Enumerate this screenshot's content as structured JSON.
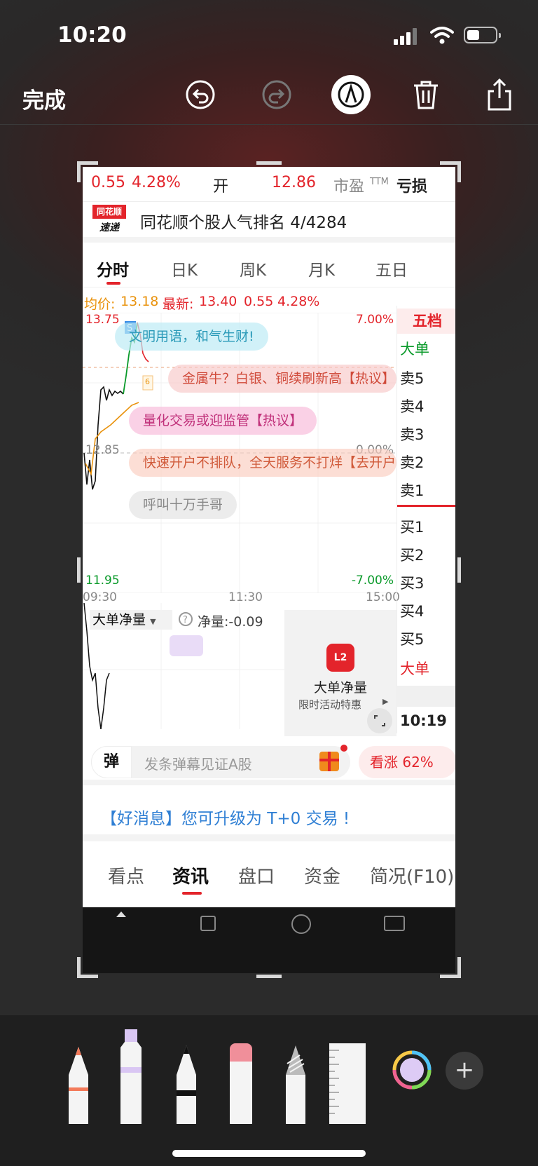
{
  "status": {
    "time": "10:20"
  },
  "toolbar": {
    "done": "完成",
    "icons": [
      "undo-icon",
      "redo-icon",
      "markup-pen-icon",
      "trash-icon",
      "share-icon"
    ]
  },
  "quote": {
    "change": "0.55",
    "percent": "4.28%",
    "open_label": "开",
    "open_value": "12.86",
    "pe_label": "市盈",
    "pe_sub": "TTM",
    "pe_value": "亏损"
  },
  "rank": {
    "logo_top": "同花顺",
    "logo_bottom": "速递",
    "text": "同花顺个股人气排名 4/4284"
  },
  "tabs": [
    "分时",
    "日K",
    "周K",
    "月K",
    "五日"
  ],
  "price_row": {
    "avg_label": "均价:",
    "avg": "13.18",
    "latest_label": "最新:",
    "latest": "13.40",
    "chg": "0.55",
    "pct": "4.28%"
  },
  "chart": {
    "y_high": "13.75",
    "y_mid": "12.85",
    "y_low": "11.95",
    "pct_high": "7.00%",
    "pct_mid": "0.00%",
    "pct_low": "-7.00%",
    "times": [
      "09:30",
      "11:30",
      "15:00"
    ],
    "marker": "6"
  },
  "bubbles": [
    "文明用语，和气生财!",
    "金属牛？白银、铜续刷新高【热议】",
    "量化交易或迎监管【热议】",
    "快速开户不排队，全天服务不打烊【去开户】",
    "呼叫十万手哥"
  ],
  "side": {
    "title": "五档",
    "big": "大单",
    "sell": [
      "卖5",
      "卖4",
      "卖3",
      "卖2",
      "卖1"
    ],
    "buy": [
      "买1",
      "买2",
      "买3",
      "买4",
      "买5"
    ],
    "big2": "大单",
    "time": "10:19"
  },
  "lower": {
    "indicator": "大单净量",
    "net_label": "净量:-0.09",
    "l2_title": "大单净量",
    "l2_sub": "限时活动特惠",
    "l2_icon": "L2"
  },
  "comment": {
    "icon_label": "弹",
    "placeholder": "发条弹幕见证A股",
    "bullish": "看涨 62%"
  },
  "news": {
    "text": "【好消息】您可升级为 T+0 交易 !"
  },
  "bottom_tabs": [
    "看点",
    "资讯",
    "盘口",
    "资金",
    "简况(F10)"
  ],
  "colors": {
    "rise": "#e3242b",
    "fall": "#0a9a2a",
    "avg": "#e9920c"
  }
}
